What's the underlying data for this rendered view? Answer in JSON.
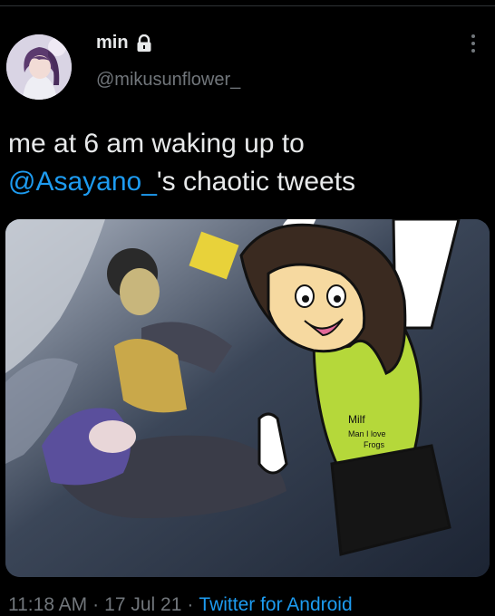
{
  "tweet": {
    "author_name": "min",
    "author_handle": "@mikusunflower_",
    "text_before": "me at 6 am waking up to",
    "mention": "@Asayano_",
    "text_after": "'s chaotic tweets",
    "time": "11:18 AM",
    "date": "17 Jul 21",
    "separator": "·",
    "source": "Twitter for Android",
    "shirt_text_1": "Milf",
    "shirt_text_2": "Man I love",
    "shirt_text_3": "Frogs"
  },
  "icons": {
    "lock": "lock-icon",
    "more": "more-vertical-icon"
  },
  "colors": {
    "background": "#000000",
    "text": "#e7e9ea",
    "secondary": "#71767b",
    "link": "#1d9bf0"
  }
}
